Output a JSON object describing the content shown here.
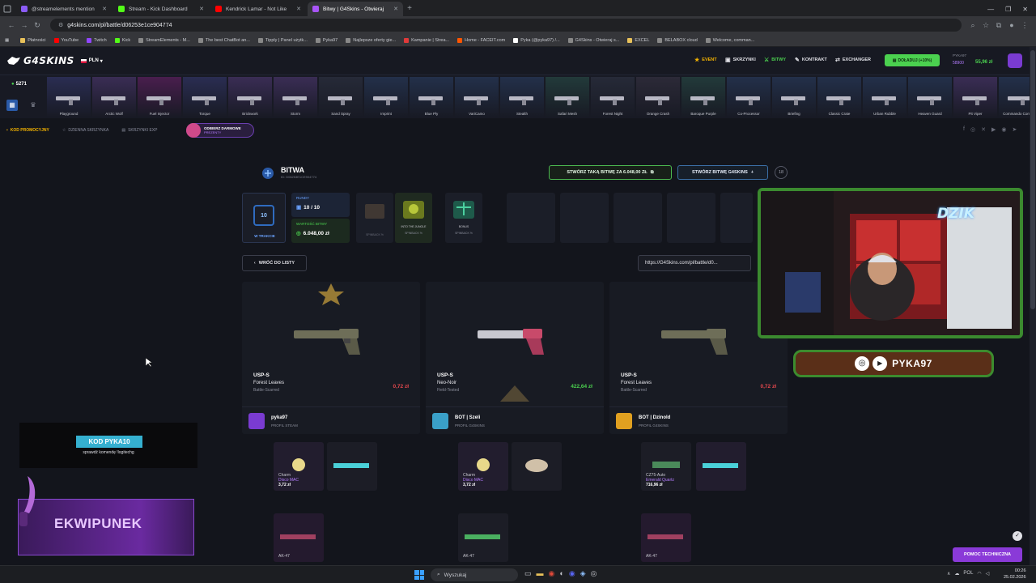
{
  "browser": {
    "tabs": [
      {
        "label": "@streamelements mention",
        "color": "#8b5cf6",
        "active": false
      },
      {
        "label": "Stream - Kick Dashboard",
        "color": "#53fc18",
        "active": false
      },
      {
        "label": "Kendrick Lamar - Not Like",
        "color": "#ff0000",
        "active": false
      },
      {
        "label": "Bitwy | G4Skins - Otwieraj",
        "color": "#a855f7",
        "active": true
      }
    ],
    "url": "g4skins.com/pl/battle/d06253e1ce904774",
    "bookmarks": [
      "Płatności",
      "YouTube",
      "Twitch",
      "Kick",
      "StreamElements - M...",
      "The best ChatBot an...",
      "Tipply | Panel użytk...",
      "Pyka97",
      "Najlepsze oferty gie...",
      "Kampanie | Strea...",
      "Home - FACEIT.com",
      "Pyka (@pyka97) /...",
      "G4Skins - Otwieraj s...",
      "EXCEL",
      "BELABOX cloud",
      "Welcome, comman..."
    ]
  },
  "site": {
    "logo": "G4SKINS",
    "currency": "PLN",
    "nav": [
      {
        "label": "EVENT",
        "icon": "star-icon",
        "color": "#f5b400"
      },
      {
        "label": "SKRZYNKI",
        "icon": "box-icon",
        "color": "#e0e0e6"
      },
      {
        "label": "BITWY",
        "icon": "swords-icon",
        "color": "#4bd14f"
      },
      {
        "label": "KONTRAKT",
        "icon": "pen-icon",
        "color": "#e0e0e6"
      },
      {
        "label": "EXCHANGER",
        "icon": "exchange-icon",
        "color": "#e0e0e6"
      }
    ],
    "deposit_label": "DOŁADUJ (+10%)",
    "user_label": "PYKA97",
    "user_balance_small": "58900",
    "user_balance": "55,96 zł",
    "live_count": "5271",
    "cases": [
      {
        "label": "Playground",
        "color": "#2a2d52"
      },
      {
        "label": "Arctic Wolf",
        "color": "#3a2d55"
      },
      {
        "label": "Fuel Injector",
        "color": "#4a1e4e"
      },
      {
        "label": "Torque",
        "color": "#2a2d52"
      },
      {
        "label": "Brickwork",
        "color": "#3a2d55"
      },
      {
        "label": "Storm",
        "color": "#3a2d55"
      },
      {
        "label": "Sand Spray",
        "color": "#262a38"
      },
      {
        "label": "Imprint",
        "color": "#23304a"
      },
      {
        "label": "Blue Ply",
        "color": "#23304a"
      },
      {
        "label": "VariCamo",
        "color": "#23304a"
      },
      {
        "label": "Stealth",
        "color": "#23304a"
      },
      {
        "label": "Safari Mesh",
        "color": "#223a3a"
      },
      {
        "label": "Forest Night",
        "color": "#262a38"
      },
      {
        "label": "Orange Crash",
        "color": "#2c2a38"
      },
      {
        "label": "Baroque Purple",
        "color": "#223a3a"
      },
      {
        "label": "Co-Processor",
        "color": "#23304a"
      },
      {
        "label": "Briefing",
        "color": "#23304a"
      },
      {
        "label": "Classic Crate",
        "color": "#23304a"
      },
      {
        "label": "Urban Rubble",
        "color": "#23304a"
      },
      {
        "label": "Heaven Guard",
        "color": "#23304a"
      },
      {
        "label": "Pit Viper",
        "color": "#3a2d55"
      },
      {
        "label": "Commando Company",
        "color": "#23304a"
      }
    ],
    "subnav": [
      "KOD PROMOCYJNY",
      "DZIENNA SKRZYNKA",
      "SKRZYNKI EXP"
    ],
    "free_gift": {
      "title": "ODBIERZ DARMOWE",
      "subtitle": "PREZENTY"
    }
  },
  "battle": {
    "title": "BITWA",
    "id": "ID: D06253E1CE904774",
    "create_same": "STWÓRZ TAKĄ BITWĘ ZA 6.048,00 ZŁ",
    "create_g4": "STWÓRZ BITWĘ G4SKINS",
    "age_badge": "18",
    "round_badge": "10",
    "status": "W TRAKCIE",
    "rounds_label": "RUNDY",
    "rounds_value": "10 / 10",
    "value_label": "WARTOŚĆ BITWY",
    "value": "6.048,00 zł",
    "cases": [
      {
        "label": "",
        "sub": "SPINBACK %"
      },
      {
        "label": "INTO THE JUNGLE",
        "sub": "SPINBACK %"
      },
      {
        "label": "BONUS",
        "sub": "SPINBACK %"
      }
    ],
    "back_label": "WRÓĆ DO LISTY",
    "share_url": "https://G4Skins.com/pl/battle/d0...",
    "players": [
      {
        "weapon": "USP-S",
        "skin": "Forest Leaves",
        "wear": "Battle-Scarred",
        "price": "0,72 zł",
        "price_color": "#e5484d",
        "user": "pyka97",
        "profile": "PROFIL STEAM",
        "avatar_color": "#7a3bd1"
      },
      {
        "weapon": "USP-S",
        "skin": "Neo-Noir",
        "wear": "Field-Tested",
        "price": "422,64 zł",
        "price_color": "#4bd14f",
        "user": "BOT | Szeli",
        "profile": "PROFIL G4SKINS",
        "avatar_color": "#3aa0c8"
      },
      {
        "weapon": "USP-S",
        "skin": "Forest Leaves",
        "wear": "Battle-Scarred",
        "price": "0,72 zł",
        "price_color": "#e5484d",
        "user": "BOT | Dzinold",
        "profile": "PROFIL G4SKINS",
        "avatar_color": "#e0a020"
      }
    ],
    "drops": [
      {
        "name": "Charm",
        "skin": "Disco MAC",
        "price": "3,72 zł"
      },
      {
        "name": "Charm",
        "skin": "Disco MAC",
        "price": "3,72 zł"
      },
      {
        "name": "CZ75-Auto",
        "skin": "Emerald Quartz",
        "price": "716,96 zł"
      }
    ],
    "lower_labels": [
      "AK-47",
      "AK-47",
      "AK-47"
    ]
  },
  "overlay": {
    "code_title": "KOD PYKA10",
    "code_sub": "sprawdź komendę !logitechg",
    "inventory": "EKWIPUNEK",
    "cam_logo": "DZIK",
    "social_handle": "PYKA97",
    "help_button": "POMOC TECHNICZNA"
  },
  "taskbar": {
    "search": "Wyszukaj",
    "lang": "POL",
    "time": "00:26",
    "date": "25.02.2026"
  }
}
